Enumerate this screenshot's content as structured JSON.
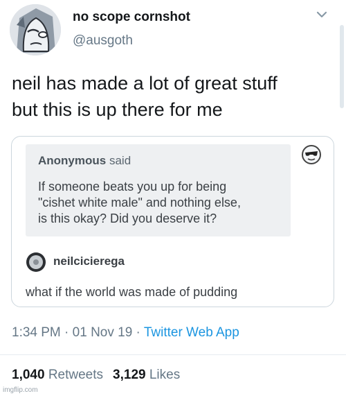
{
  "tweet": {
    "display_name": "no scope cornshot",
    "handle": "@ausgoth",
    "text_line1": "neil has made a lot of great stuff",
    "text_line2": "but this is up there for me"
  },
  "embed": {
    "ask": {
      "asker": "Anonymous",
      "said": "said",
      "line1": "If someone beats you up for being",
      "line2": "\"cishet white male\" and nothing else,",
      "line3": "is this okay? Did you deserve it?"
    },
    "reply": {
      "username": "neilcicierega",
      "text": "what if the world was made of pudding"
    }
  },
  "meta": {
    "time": "1:34 PM",
    "sep1": " · ",
    "date": "01 Nov 19",
    "sep2": " · ",
    "source": "Twitter Web App"
  },
  "stats": {
    "retweets_count": "1,040",
    "retweets_label": "Retweets",
    "likes_count": "3,129",
    "likes_label": "Likes"
  },
  "watermark": "imgflip.com",
  "colors": {
    "link": "#1b95e0",
    "secondary": "#657786",
    "text": "#14171a"
  }
}
